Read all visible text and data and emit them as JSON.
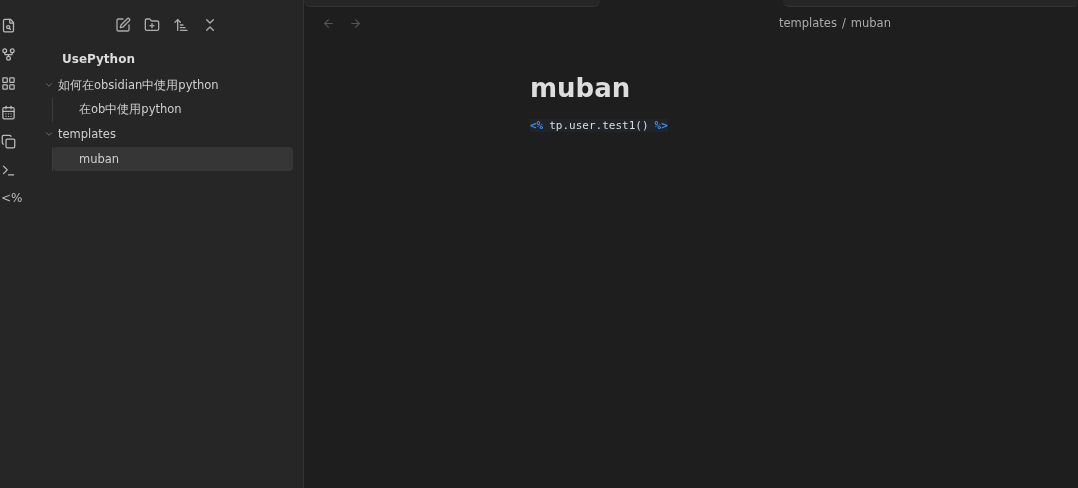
{
  "ribbon": {
    "templater_glyph": "<%"
  },
  "file_explorer": {
    "vault_name": "UsePython",
    "tree": [
      {
        "label": "如何在obsidian中使用python",
        "expanded": true,
        "selected": false,
        "children": [
          {
            "label": "在ob中使用python",
            "selected": false
          }
        ]
      },
      {
        "label": "templates",
        "expanded": true,
        "selected": false,
        "children": [
          {
            "label": "muban",
            "selected": true
          }
        ]
      }
    ]
  },
  "breadcrumb": [
    "templates",
    "/",
    "muban"
  ],
  "note": {
    "title": "muban",
    "code": {
      "open": "<%",
      "body": "tp.user.test1()",
      "close": "%>"
    }
  }
}
